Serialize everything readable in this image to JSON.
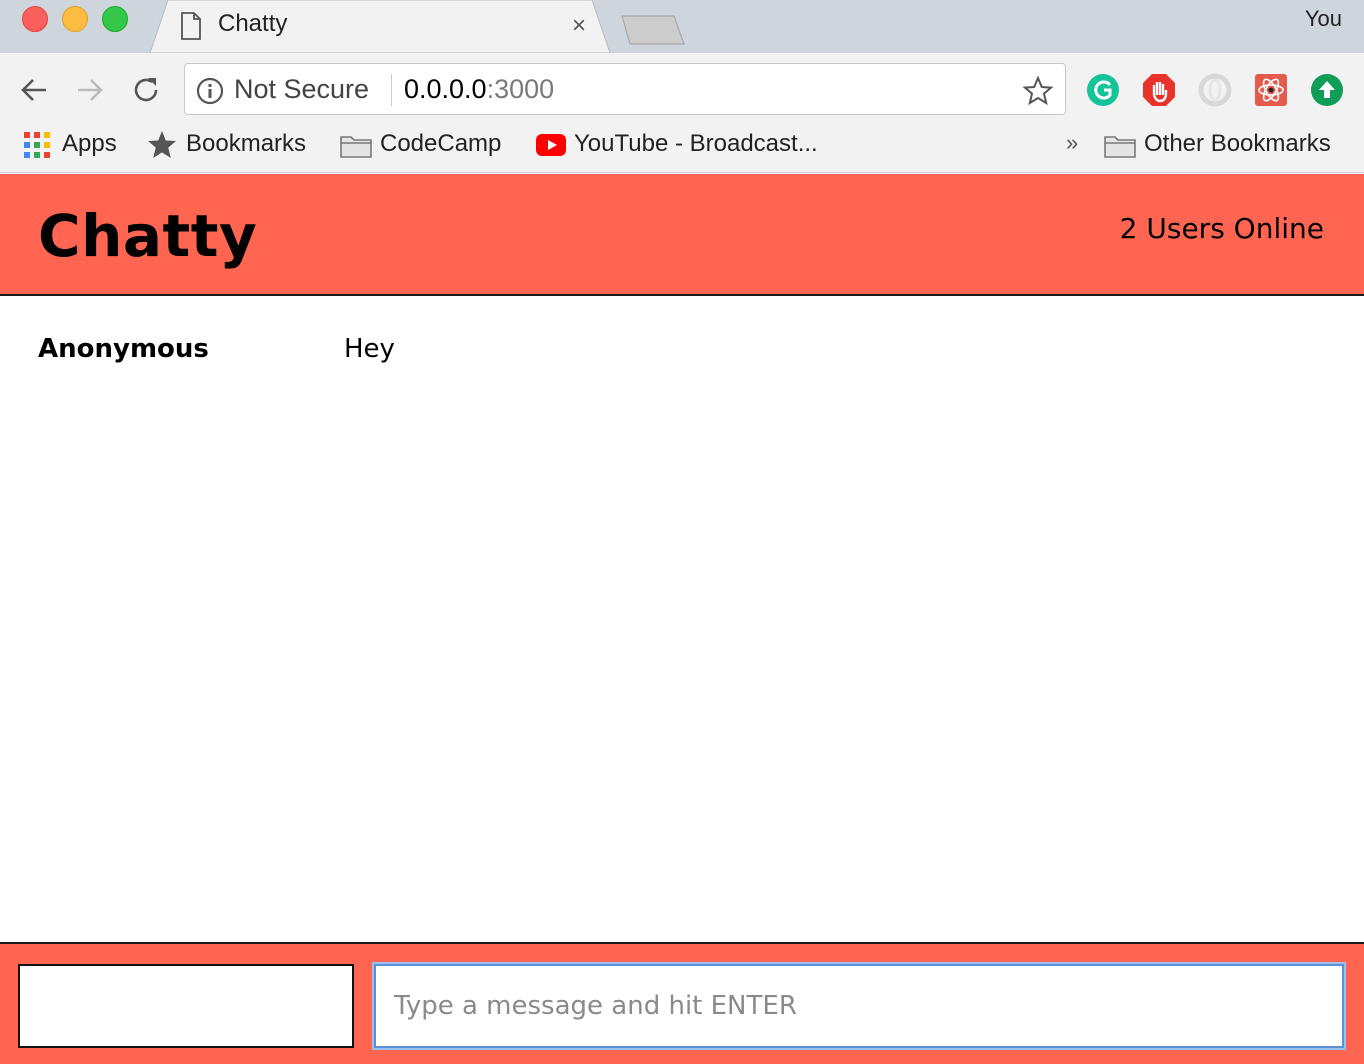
{
  "browser": {
    "tab_title": "Chatty",
    "tab_close": "×",
    "profile": "You",
    "security_label": "Not Secure",
    "url_host": "0.0.0.0",
    "url_port": ":3000",
    "bookmarks": {
      "apps": "Apps",
      "bookmarks": "Bookmarks",
      "codecamp": "CodeCamp",
      "youtube": "YouTube - Broadcast...",
      "overflow": "»",
      "other": "Other Bookmarks"
    },
    "extensions": [
      "grammarly-icon",
      "adblock-icon",
      "opera-icon",
      "react-devtools-icon",
      "upload-icon"
    ]
  },
  "app": {
    "title": "Chatty",
    "users_online": "2 Users Online",
    "accent_color": "#ff6550",
    "messages": [
      {
        "username": "Anonymous",
        "content": "Hey"
      }
    ],
    "composer": {
      "username_value": "",
      "message_placeholder": "Type a message and hit ENTER"
    }
  }
}
